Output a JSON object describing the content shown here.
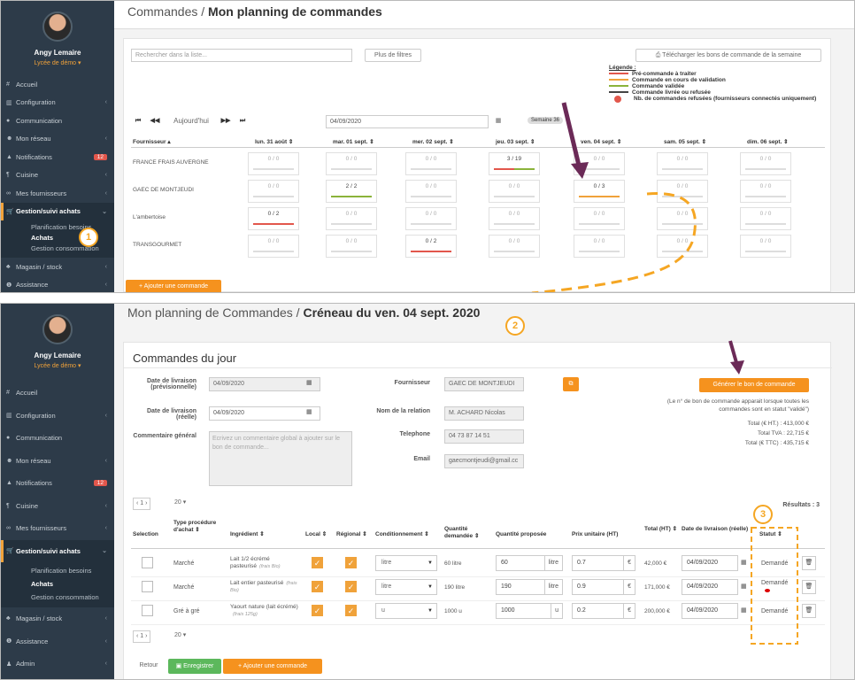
{
  "user": {
    "name": "Angy Lemaire",
    "school": "Lycée de démo ▾"
  },
  "sidebar1": [
    {
      "label": "Accueil",
      "icon": "#",
      "chev": ""
    },
    {
      "label": "Configuration",
      "icon": "▥",
      "chev": "‹"
    },
    {
      "label": "Communication",
      "icon": "●",
      "chev": ""
    },
    {
      "label": "Mon réseau",
      "icon": "☻",
      "chev": "‹"
    },
    {
      "label": "Notifications",
      "icon": "▲",
      "chev": "",
      "badge": "12"
    },
    {
      "label": "Cuisine",
      "icon": "¶",
      "chev": "‹"
    },
    {
      "label": "Mes fournisseurs",
      "icon": "∞",
      "chev": "‹"
    }
  ],
  "sidebar_gest": "Gestion/suivi achats",
  "submenu": [
    "Planification besoins",
    "Achats",
    "Gestion consommation"
  ],
  "sidebar_after": [
    {
      "label": "Magasin / stock",
      "icon": "♣",
      "chev": "‹"
    },
    {
      "label": "Assistance",
      "icon": "❶",
      "chev": "‹"
    }
  ],
  "sidebar2_extra": {
    "label": "Admin",
    "icon": "♟",
    "chev": "‹"
  },
  "p1": {
    "title_pre": "Commandes / ",
    "title_bold": "Mon planning de commandes",
    "search_placeholder": "Rechercher dans la liste...",
    "more_filters": "Plus de filtres",
    "download": "Télécharger les bons de commande de la semaine",
    "legend_title": "Légende :",
    "legend": [
      {
        "color": "#e2574c",
        "label": "Pré-commande à traiter"
      },
      {
        "color": "#f0a23a",
        "label": "Commande en cours de validation"
      },
      {
        "color": "#8bb33a",
        "label": "Commande validée"
      },
      {
        "color": "#444444",
        "label": "Commande livrée ou refusée"
      }
    ],
    "legend_refused": "Nb. de commandes refusées (fournisseurs connectés uniquement)",
    "today": "Aujourd'hui",
    "date": "04/09/2020",
    "week": "Semaine 36",
    "cols": [
      "Fournisseur ▴",
      "lun. 31 août ⇕",
      "mar. 01 sept. ⇕",
      "mer. 02 sept. ⇕",
      "jeu. 03 sept. ⇕",
      "ven. 04 sept. ⇕",
      "sam. 05 sept. ⇕",
      "dim. 06 sept. ⇕"
    ],
    "rows": [
      {
        "name": "FRANCE FRAIS AUVERGNE",
        "cells": [
          "0 / 0",
          "0 / 0",
          "0 / 0",
          "3 / 19",
          "0 / 0",
          "0 / 0",
          "0 / 0"
        ]
      },
      {
        "name": "GAEC DE MONTJEUDI",
        "cells": [
          "0 / 0",
          "2 / 2",
          "0 / 0",
          "0 / 0",
          "0 / 3",
          "0 / 0",
          "0 / 0"
        ]
      },
      {
        "name": "L'ambertoise",
        "cells": [
          "0 / 2",
          "0 / 0",
          "0 / 0",
          "0 / 0",
          "0 / 0",
          "0 / 0",
          "0 / 0"
        ]
      },
      {
        "name": "TRANSGOURMET",
        "cells": [
          "0 / 0",
          "0 / 0",
          "0 / 2",
          "0 / 0",
          "0 / 0",
          "0 / 0",
          "0 / 0"
        ]
      }
    ],
    "add": "+ Ajouter une commande"
  },
  "p2": {
    "title_pre": "Mon planning de Commandes / ",
    "title_bold": "Créneau du ven. 04 sept. 2020",
    "section": "Commandes du jour",
    "lbl_prev": "Date de livraison (prévisionnelle)",
    "val_prev": "04/09/2020",
    "lbl_real": "Date de livraison (réelle)",
    "val_real": "04/09/2020",
    "lbl_comment": "Commentaire général",
    "comment_ph": "Ecrivez un commentaire global à ajouter sur le bon de commande...",
    "lbl_supplier": "Fournisseur",
    "val_supplier": "GAEC DE MONTJEUDI",
    "lbl_relation": "Nom de la relation",
    "val_relation": "M. ACHARD Nicolas",
    "lbl_phone": "Telephone",
    "val_phone": "04 73 87 14 51",
    "lbl_email": "Email",
    "val_email": "gaecmontjeudi@gmail.cc",
    "gen_btn": "Générer le bon de commande",
    "note": "(Le n° de bon de commande apparait lorsque toutes les commandes sont en statut \"validé\")",
    "total_ht": "Total (€ HT.) : 413,000 €",
    "total_tva": "Total TVA : 22,715 €",
    "total_ttc": "Total (€ TTC) : 435,715 €",
    "results": "Résultats : 3",
    "page": "1",
    "per_page": "20",
    "cols": [
      "Selection",
      "Type procédure d'achat ⇕",
      "Ingrédient ⇕",
      "Local ⇕",
      "Régional ⇕",
      "Conditionnement ⇕",
      "Quantité demandée ⇕",
      "Quantité proposée",
      "Prix unitaire (HT)",
      "Total (HT) ⇕",
      "Date de livraison (réelle)",
      "Statut ⇕"
    ],
    "rows": [
      {
        "type": "Marché",
        "ing": "Lait 1/2 écrémé pasteurisé",
        "sub": "(frais Bio)",
        "cond": "litre",
        "qd": "60 litre",
        "qp": "60",
        "unit": "litre",
        "pu": "0.7",
        "total": "42,000 €",
        "date": "04/09/2020",
        "status": "Demandé"
      },
      {
        "type": "Marché",
        "ing": "Lait entier pasteurisé",
        "sub": "(frais Bio)",
        "cond": "litre",
        "qd": "190 litre",
        "qp": "190",
        "unit": "litre",
        "pu": "0.9",
        "total": "171,000 €",
        "date": "04/09/2020",
        "status": "Demandé"
      },
      {
        "type": "Gré à gré",
        "ing": "Yaourt nature (lait écrémé)",
        "sub": "(frais 125g)",
        "cond": "u",
        "qd": "1000 u",
        "qp": "1000",
        "unit": "u",
        "pu": "0.2",
        "total": "200,000 €",
        "date": "04/09/2020",
        "status": "Demandé"
      }
    ],
    "back": "Retour",
    "save": "Enregistrer",
    "add": "+ Ajouter une commande"
  },
  "callouts": [
    "1",
    "2",
    "3"
  ],
  "colors": {
    "orange": "#f5921e",
    "sidebar": "#2d3b49",
    "red": "#e2574c",
    "green": "#8bb33a"
  }
}
